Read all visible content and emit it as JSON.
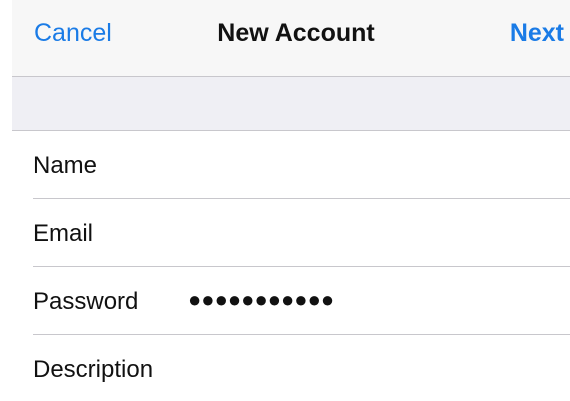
{
  "navbar": {
    "cancel_label": "Cancel",
    "title": "New Account",
    "next_label": "Next"
  },
  "form": {
    "fields": [
      {
        "label": "Name",
        "value": ""
      },
      {
        "label": "Email",
        "value": ""
      },
      {
        "label": "Password",
        "value": "●●●●●●●●●●●"
      },
      {
        "label": "Description",
        "value": ""
      }
    ]
  },
  "colors": {
    "accent": "#1a7be6",
    "navbar_bg": "#f7f7f7",
    "section_bg": "#efeff4",
    "separator": "#c8c7cc"
  }
}
